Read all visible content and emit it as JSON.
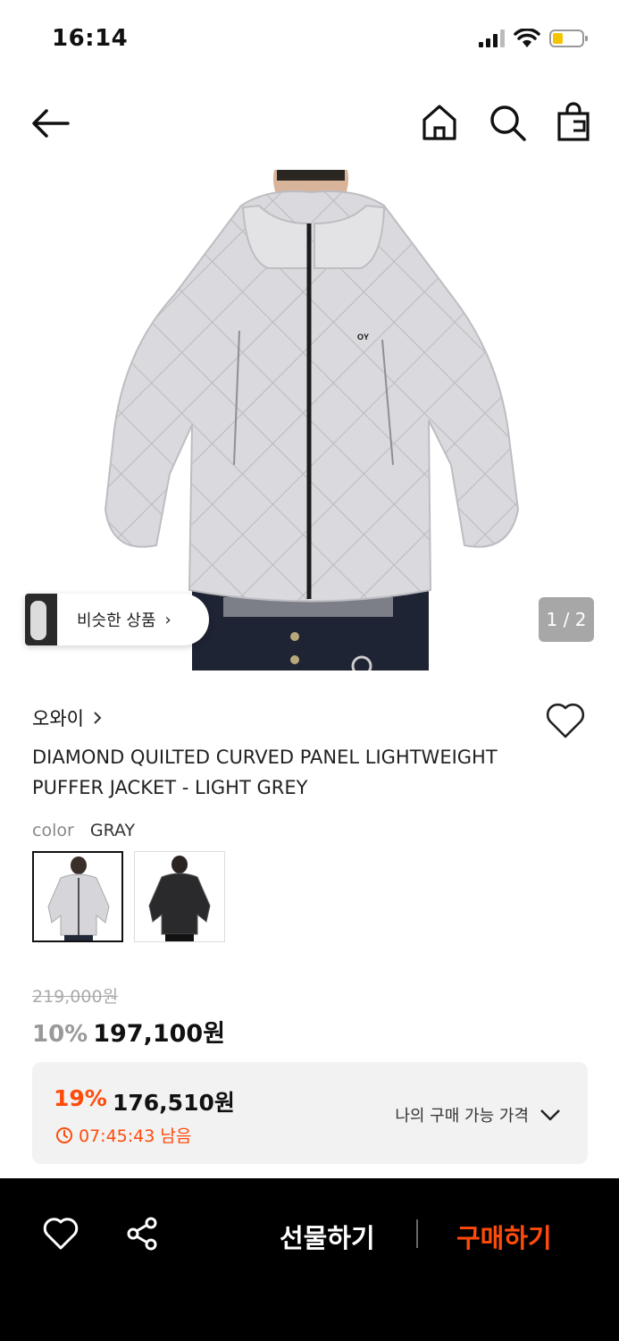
{
  "status": {
    "time": "16:14"
  },
  "hero": {
    "pager": "1 / 2",
    "similar_label": "비슷한 상품"
  },
  "product": {
    "brand": "오와이",
    "title": "DIAMOND QUILTED CURVED PANEL LIGHTWEIGHT PUFFER JACKET - LIGHT GREY",
    "color_key": "color",
    "color_value": "GRAY",
    "original_price": "219,000원",
    "discount": "10%",
    "price": "197,100원"
  },
  "promo": {
    "discount": "19%",
    "price": "176,510원",
    "timer": "07:45:43 남음",
    "my_price_label": "나의 구매 가능 가격"
  },
  "bottom": {
    "gift_label": "선물하기",
    "buy_label": "구매하기"
  },
  "colors": {
    "accent": "#ff4b0a",
    "bottom_bar": "#000000",
    "jacket_light": "#d9d9dc"
  }
}
